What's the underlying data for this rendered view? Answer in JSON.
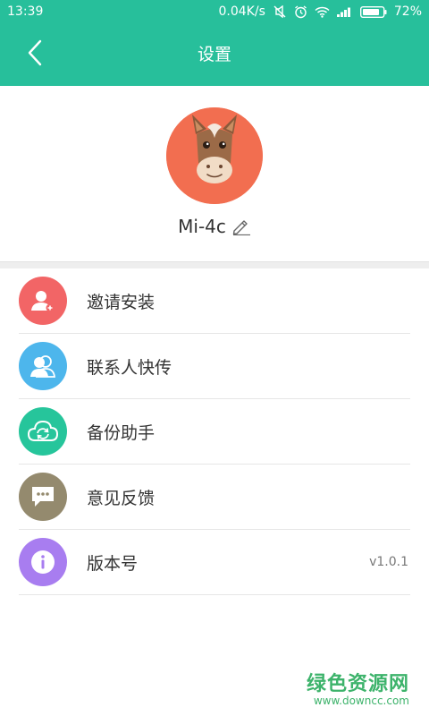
{
  "status": {
    "time": "13:39",
    "speed": "0.04K/s",
    "battery": "72%",
    "icons": [
      "mute-icon",
      "alarm-icon",
      "wifi-icon",
      "signal-icon",
      "battery-icon"
    ]
  },
  "header": {
    "title": "设置",
    "back_icon": "back-arrow-icon"
  },
  "profile": {
    "device_name": "Mi-4c",
    "avatar_icon": "horse-avatar",
    "edit_icon": "pencil-icon"
  },
  "menu": {
    "items": [
      {
        "label": "邀请安装",
        "icon": "add-user-icon",
        "color": "#f26566",
        "value": ""
      },
      {
        "label": "联系人快传",
        "icon": "contacts-icon",
        "color": "#4db6ec",
        "value": ""
      },
      {
        "label": "备份助手",
        "icon": "cloud-sync-icon",
        "color": "#26c59b",
        "value": ""
      },
      {
        "label": "意见反馈",
        "icon": "chat-bubble-icon",
        "color": "#948a6e",
        "value": ""
      },
      {
        "label": "版本号",
        "icon": "info-icon",
        "color": "#a87df0",
        "value": "v1.0.1"
      }
    ]
  },
  "watermark": {
    "main": "绿色资源网",
    "sub": "www.downcc.com"
  },
  "colors": {
    "primary": "#27bf9b",
    "divider": "#eeeeee"
  }
}
